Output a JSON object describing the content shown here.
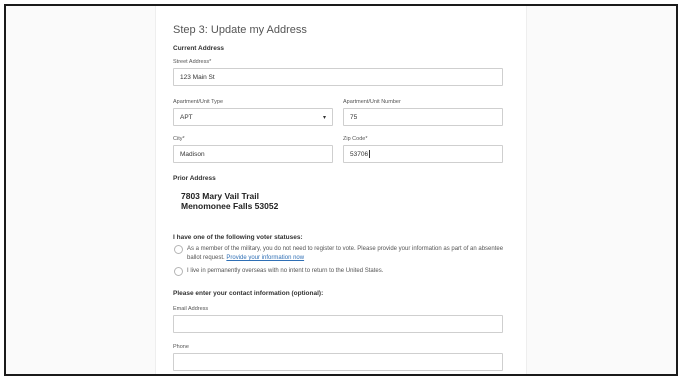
{
  "page": {
    "title": "Step 3: Update my Address"
  },
  "current_address": {
    "heading": "Current Address",
    "street": {
      "label": "Street Address*",
      "value": "123 Main St"
    },
    "apt_type": {
      "label": "Apartment/Unit Type",
      "value": "APT"
    },
    "apt_number": {
      "label": "Apartment/Unit Number",
      "value": "75"
    },
    "city": {
      "label": "City*",
      "value": "Madison"
    },
    "zip": {
      "label": "Zip Code*",
      "value": "53706"
    }
  },
  "prior_address": {
    "heading": "Prior Address",
    "line1": "7803 Mary Vail Trail",
    "line2": "Menomonee Falls  53052"
  },
  "voter_status": {
    "heading": "I have one of the following voter statuses:",
    "option_military_text": "As a member of the military, you do not need to register to vote. Please provide your information as part of an absentee ballot request.",
    "option_military_link": "Provide your information now",
    "option_overseas_text": "I live in permanently overseas with no intent to return to the United States."
  },
  "contact": {
    "heading": "Please enter your contact information (optional):",
    "email": {
      "label": "Email Address",
      "value": ""
    },
    "phone": {
      "label": "Phone",
      "value": ""
    }
  },
  "icons": {
    "select_arrow": "chevron-down-icon",
    "radio": "radio-circle-icon"
  }
}
